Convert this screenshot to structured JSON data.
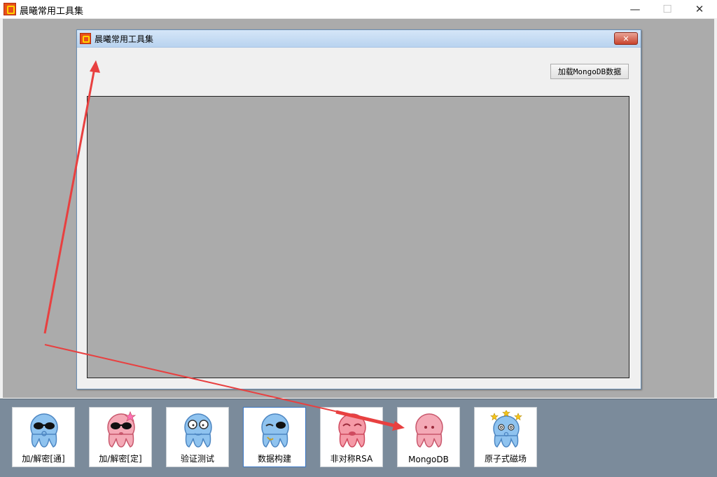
{
  "app": {
    "title": "晨曦常用工具集"
  },
  "window_controls": {
    "minimize": "—",
    "maximize": "☐",
    "close": "✕"
  },
  "child_window": {
    "title": "晨曦常用工具集",
    "close": "✕",
    "load_button": "加载MongoDB数据"
  },
  "toolbar": {
    "items": [
      {
        "label": "加/解密[通]",
        "icon": "octopus-sunglasses-blue-icon",
        "color": "#8fc3ef"
      },
      {
        "label": "加/解密[定]",
        "icon": "octopus-sunglasses-pink-icon",
        "color": "#f4a9b6"
      },
      {
        "label": "验证测试",
        "icon": "octopus-glasses-blue-icon",
        "color": "#8fc3ef"
      },
      {
        "label": "数据构建",
        "icon": "octopus-wink-blue-icon",
        "color": "#8fc3ef"
      },
      {
        "label": "非对称RSA",
        "icon": "octopus-laughing-pink-icon",
        "color": "#f59aa7"
      },
      {
        "label": "MongoDB",
        "icon": "octopus-pink-icon",
        "color": "#f4a9b6"
      },
      {
        "label": "原子式磁场",
        "icon": "octopus-dizzy-blue-icon",
        "color": "#8fc3ef"
      }
    ]
  },
  "colors": {
    "mdi_background": "#ababab",
    "toolbar_background": "#7b8b9b",
    "annotation_arrow": "#e84040"
  }
}
